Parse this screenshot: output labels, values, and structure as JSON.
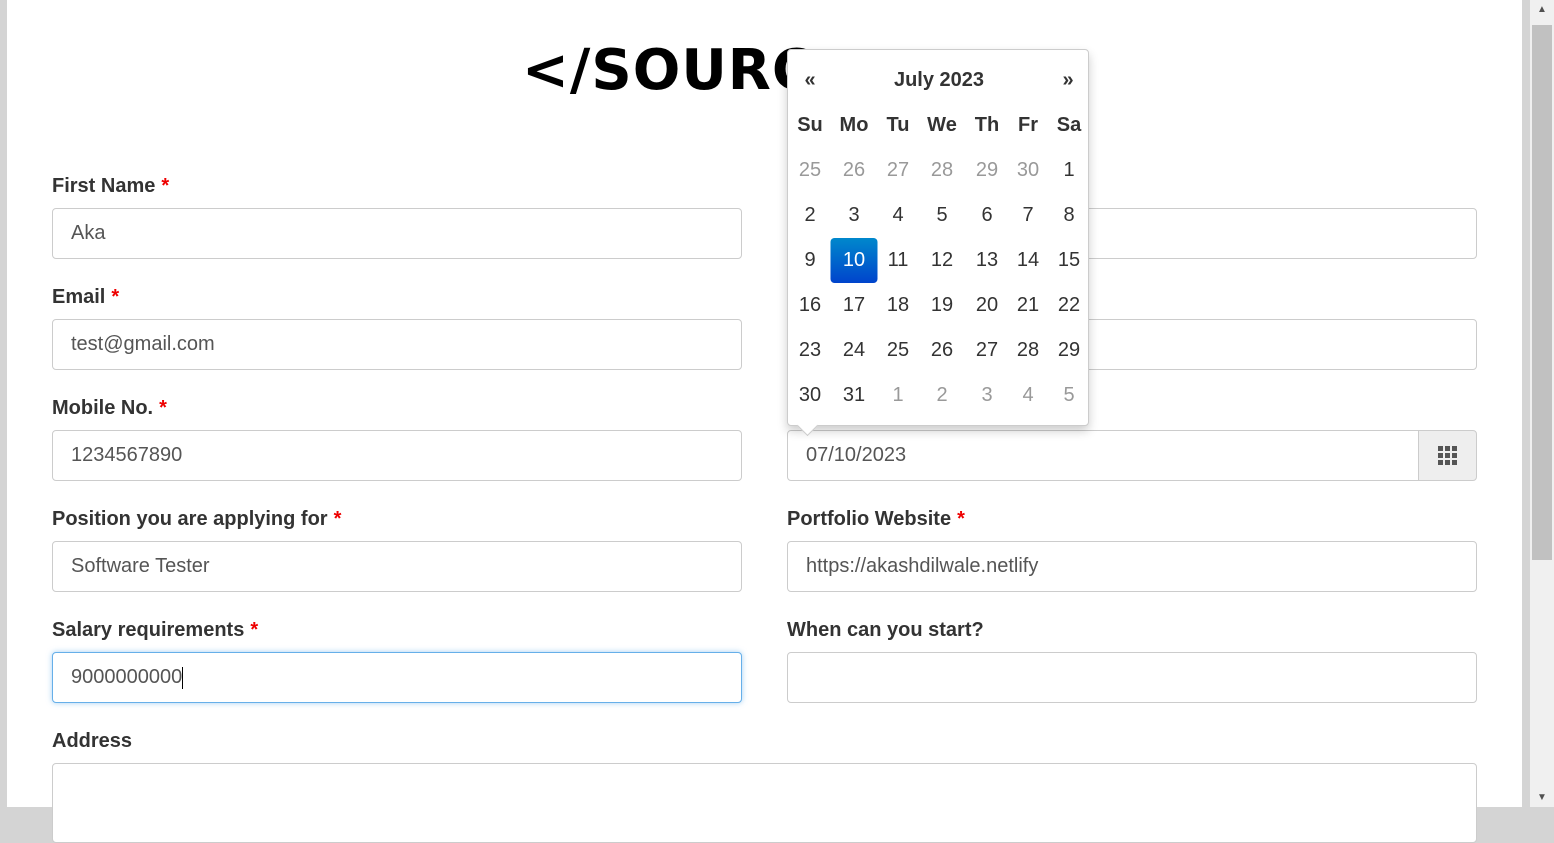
{
  "logo": "</SOURC",
  "form": {
    "first_name": {
      "label": "First Name",
      "value": "Aka"
    },
    "email": {
      "label": "Email",
      "value": "test@gmail.com"
    },
    "mobile": {
      "label": "Mobile No.",
      "value": "1234567890"
    },
    "date": {
      "value": "07/10/2023"
    },
    "position": {
      "label": "Position you are applying for",
      "value": "Software Tester"
    },
    "portfolio": {
      "label": "Portfolio Website",
      "value": "https://akashdilwale.netlify"
    },
    "salary": {
      "label": "Salary requirements",
      "value": "9000000000"
    },
    "start": {
      "label": "When can you start?",
      "value": ""
    },
    "address": {
      "label": "Address",
      "value": ""
    },
    "required_mark": "*"
  },
  "datepicker": {
    "prev": "«",
    "next": "»",
    "title": "July 2023",
    "weekdays": [
      "Su",
      "Mo",
      "Tu",
      "We",
      "Th",
      "Fr",
      "Sa"
    ],
    "weeks": [
      [
        "25",
        "26",
        "27",
        "28",
        "29",
        "30",
        "1"
      ],
      [
        "2",
        "3",
        "4",
        "5",
        "6",
        "7",
        "8"
      ],
      [
        "9",
        "10",
        "11",
        "12",
        "13",
        "14",
        "15"
      ],
      [
        "16",
        "17",
        "18",
        "19",
        "20",
        "21",
        "22"
      ],
      [
        "23",
        "24",
        "25",
        "26",
        "27",
        "28",
        "29"
      ],
      [
        "30",
        "31",
        "1",
        "2",
        "3",
        "4",
        "5"
      ]
    ],
    "selected": "10"
  },
  "colors": {
    "accent": "#0866c6",
    "required": "#ee0000"
  }
}
